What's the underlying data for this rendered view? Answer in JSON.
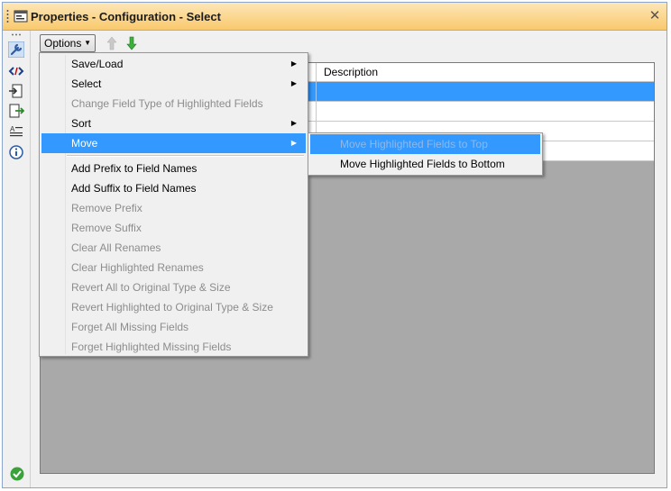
{
  "window": {
    "title": "Properties - Configuration - Select"
  },
  "toolbar": {
    "options_label": "Options"
  },
  "grid": {
    "columns": [
      "",
      "Description"
    ]
  },
  "menu": {
    "items": [
      {
        "label": "Save/Load",
        "enabled": true,
        "submenu": true
      },
      {
        "label": "Select",
        "enabled": true,
        "submenu": true
      },
      {
        "label": "Change Field Type of Highlighted Fields",
        "enabled": false,
        "submenu": false
      },
      {
        "label": "Sort",
        "enabled": true,
        "submenu": true
      },
      {
        "label": "Move",
        "enabled": true,
        "submenu": true,
        "highlighted": true
      },
      {
        "label": "Add Prefix to Field Names",
        "enabled": true
      },
      {
        "label": "Add Suffix to Field Names",
        "enabled": true
      },
      {
        "label": "Remove Prefix",
        "enabled": false
      },
      {
        "label": "Remove Suffix",
        "enabled": false
      },
      {
        "label": "Clear All Renames",
        "enabled": false
      },
      {
        "label": "Clear Highlighted Renames",
        "enabled": false
      },
      {
        "label": "Revert All to Original Type & Size",
        "enabled": false
      },
      {
        "label": "Revert Highlighted to Original Type & Size",
        "enabled": false
      },
      {
        "label": "Forget All Missing Fields",
        "enabled": false
      },
      {
        "label": "Forget Highlighted Missing Fields",
        "enabled": false
      }
    ]
  },
  "submenu": {
    "items": [
      {
        "label": "Move Highlighted Fields to Top",
        "enabled": false,
        "highlighted": true
      },
      {
        "label": "Move Highlighted Fields to Bottom",
        "enabled": true
      }
    ]
  },
  "icons": {
    "title": "properties-icon",
    "strip": [
      "wrench-icon",
      "xml-tags-icon",
      "input-icon",
      "output-icon",
      "text-annotation-icon",
      "info-icon"
    ],
    "status": "checkmark-ok-icon"
  },
  "colors": {
    "title_bar": "#f9c96c",
    "highlight": "#3399ff",
    "grid_background": "#a9a9a9"
  }
}
